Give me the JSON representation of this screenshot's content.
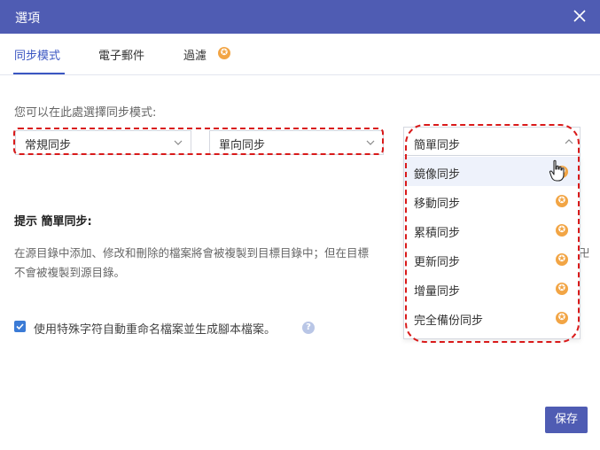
{
  "window": {
    "title": "選項"
  },
  "tabs": [
    {
      "label": "同步模式",
      "active": true
    },
    {
      "label": "電子郵件"
    },
    {
      "label": "過濾",
      "badge": "star"
    }
  ],
  "sync": {
    "description": "您可以在此處選擇同步模式:",
    "mode_select_value": "常規同步",
    "direction_select_value": "單向同步"
  },
  "dropdown": {
    "selected": "簡單同步",
    "options": [
      {
        "label": "鏡像同步",
        "badge": "star",
        "hovered": true
      },
      {
        "label": "移動同步",
        "badge": "star"
      },
      {
        "label": "累積同步",
        "badge": "star"
      },
      {
        "label": "更新同步",
        "badge": "star"
      },
      {
        "label": "增量同步",
        "badge": "star"
      },
      {
        "label": "完全備份同步",
        "badge": "star"
      }
    ]
  },
  "hint": {
    "title": "提示 簡單同步:",
    "text_line1": "在源目錄中添加、修改和刪除的檔案將會被複製到目標目錄中；但在目標",
    "text_tail": "卍",
    "text_line2": "不會被複製到源目錄。"
  },
  "option": {
    "label": "使用特殊字符自動重命名檔案並生成腳本檔案。",
    "checked": true,
    "help_icon": "?"
  },
  "footer": {
    "save_label": "保存"
  },
  "colors": {
    "titlebar": "#4f5cb3",
    "accent": "#3b56c2",
    "star_badge": "#f2a545",
    "annotation": "#d91a1a"
  }
}
